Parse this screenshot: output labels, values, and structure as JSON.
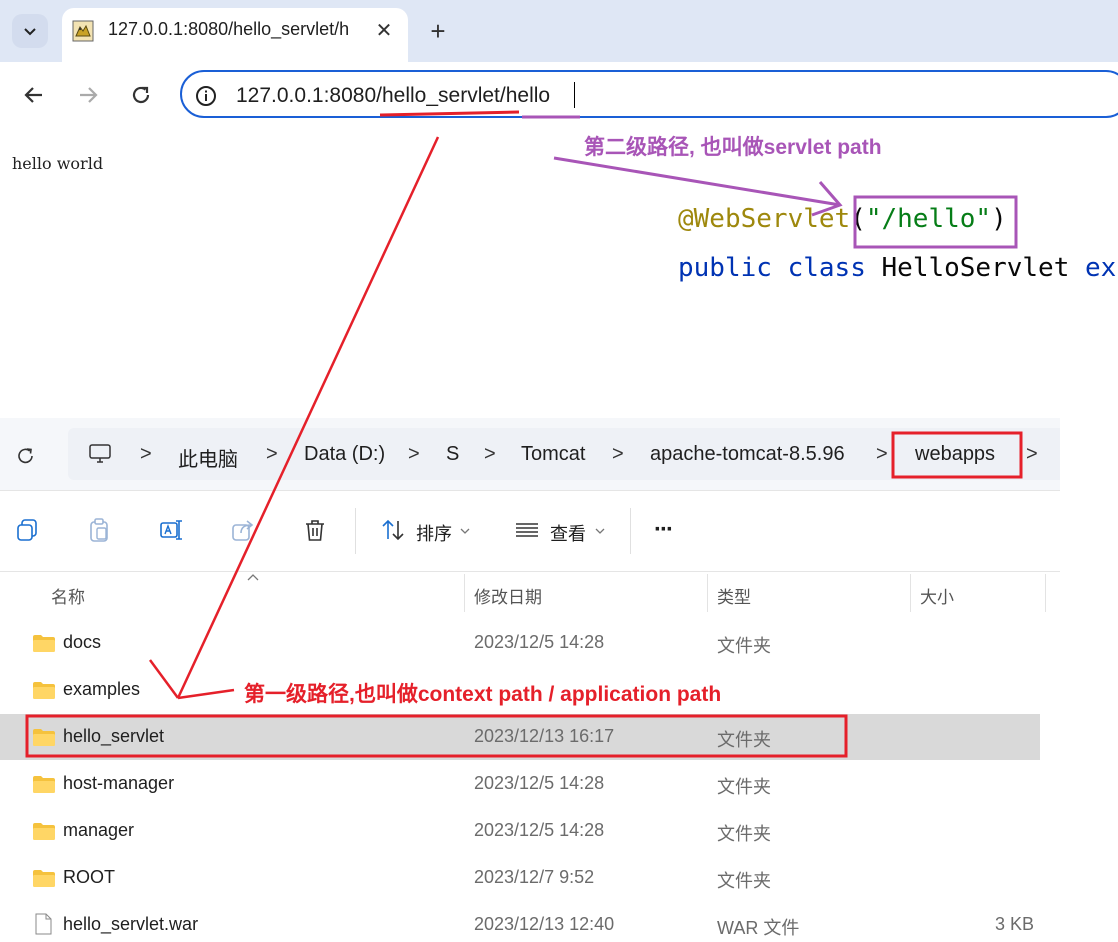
{
  "browser": {
    "tab_title": "127.0.0.1:8080/hello_servlet/h",
    "url_host": "127.0.0.1:8080",
    "url_context": "/hello_servlet",
    "url_servlet": "/hello",
    "close_glyph": "✕",
    "new_tab_glyph": "+"
  },
  "page": {
    "body_text": "hello world"
  },
  "code": {
    "annotation": "@WebServlet",
    "open_paren": "(",
    "path_string": "\"/hello\"",
    "close_paren": ")",
    "kw_public": "public",
    "kw_class": "class",
    "class_name": "HelloServlet",
    "trailing": "ex"
  },
  "annotations": {
    "servlet_path_label": "第二级路径, 也叫做servlet path",
    "context_path_label": "第一级路径,也叫做context path / application path",
    "purple_color": "#a855b7",
    "red_color": "#e5202a"
  },
  "explorer": {
    "breadcrumbs": [
      "此电脑",
      "Data (D:)",
      "S",
      "Tomcat",
      "apache-tomcat-8.5.96",
      "webapps"
    ],
    "separator": ">",
    "commands": {
      "sort": "排序",
      "view": "查看",
      "more": "···"
    },
    "columns": {
      "name": "名称",
      "modified": "修改日期",
      "type": "类型",
      "size": "大小"
    },
    "rows": [
      {
        "name": "docs",
        "date": "2023/12/5 14:28",
        "type": "文件夹",
        "size": "",
        "kind": "folder"
      },
      {
        "name": "examples",
        "date": "",
        "type": "",
        "size": "",
        "kind": "folder"
      },
      {
        "name": "hello_servlet",
        "date": "2023/12/13 16:17",
        "type": "文件夹",
        "size": "",
        "kind": "folder"
      },
      {
        "name": "host-manager",
        "date": "2023/12/5 14:28",
        "type": "文件夹",
        "size": "",
        "kind": "folder"
      },
      {
        "name": "manager",
        "date": "2023/12/5 14:28",
        "type": "文件夹",
        "size": "",
        "kind": "folder"
      },
      {
        "name": "ROOT",
        "date": "2023/12/7 9:52",
        "type": "文件夹",
        "size": "",
        "kind": "folder"
      },
      {
        "name": "hello_servlet.war",
        "date": "2023/12/13 12:40",
        "type": "WAR 文件",
        "size": "3 KB",
        "kind": "file"
      }
    ]
  }
}
